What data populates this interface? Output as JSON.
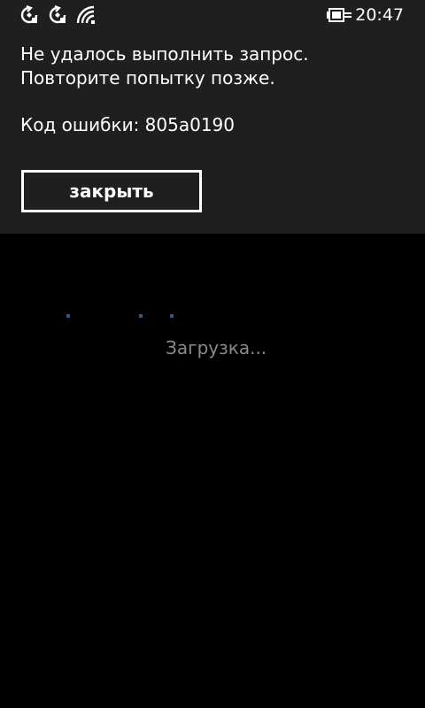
{
  "status_bar": {
    "time": "20:47",
    "icons": [
      "sync-icon",
      "sync-icon",
      "wifi-icon",
      "battery-charging-icon"
    ]
  },
  "dialog": {
    "message_line1": "Не удалось выполнить запрос.",
    "message_line2": "Повторите попытку позже.",
    "error_code": "Код ошибки: 805a0190",
    "close_label": "закрыть"
  },
  "loading": {
    "text": "Загрузка..."
  },
  "colors": {
    "dialog_background": "#1f1f1f",
    "screen_background": "#000000",
    "text": "#ffffff",
    "loading_text": "#8a8a8a",
    "progress_dots": "#2c5a8a"
  }
}
